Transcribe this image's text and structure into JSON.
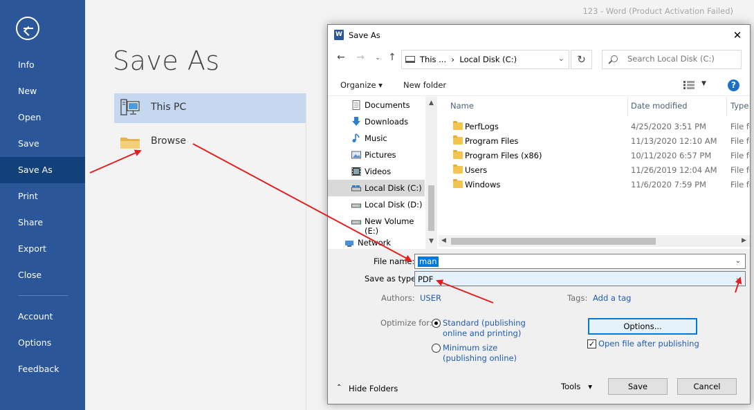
{
  "window_title": "123 - Word (Product Activation Failed)",
  "sidebar": {
    "items": [
      {
        "label": "Info",
        "active": false
      },
      {
        "label": "New",
        "active": false
      },
      {
        "label": "Open",
        "active": false
      },
      {
        "label": "Save",
        "active": false
      },
      {
        "label": "Save As",
        "active": true
      },
      {
        "label": "Print",
        "active": false
      },
      {
        "label": "Share",
        "active": false
      },
      {
        "label": "Export",
        "active": false
      },
      {
        "label": "Close",
        "active": false
      }
    ],
    "bottom_items": [
      {
        "label": "Account"
      },
      {
        "label": "Options"
      },
      {
        "label": "Feedback"
      }
    ]
  },
  "main": {
    "title": "Save As",
    "locations": [
      {
        "label": "This PC",
        "icon": "computer-icon",
        "selected": true
      },
      {
        "label": "Browse",
        "icon": "folder-icon",
        "selected": false
      }
    ]
  },
  "dialog": {
    "title": "Save As",
    "address": {
      "path_parts": [
        "This ...",
        "Local Disk (C:)"
      ],
      "search_placeholder": "Search Local Disk (C:)"
    },
    "toolbar": {
      "organize": "Organize",
      "new_folder": "New folder"
    },
    "nav_pane": [
      {
        "label": "Documents",
        "icon": "documents-icon"
      },
      {
        "label": "Downloads",
        "icon": "downloads-icon"
      },
      {
        "label": "Music",
        "icon": "music-icon"
      },
      {
        "label": "Pictures",
        "icon": "pictures-icon"
      },
      {
        "label": "Videos",
        "icon": "videos-icon"
      },
      {
        "label": "Local Disk (C:)",
        "icon": "drive-icon",
        "selected": true
      },
      {
        "label": "Local Disk (D:)",
        "icon": "drive-icon"
      },
      {
        "label": "New Volume (E:)",
        "icon": "drive-icon"
      },
      {
        "label": "Network",
        "icon": "network-icon"
      }
    ],
    "file_list": {
      "columns": [
        "Name",
        "Date modified",
        "Type"
      ],
      "rows": [
        {
          "name": "PerfLogs",
          "date": "4/25/2020 3:51 PM",
          "type": "File fo"
        },
        {
          "name": "Program Files",
          "date": "11/13/2020 12:10 AM",
          "type": "File fo"
        },
        {
          "name": "Program Files (x86)",
          "date": "10/11/2020 6:57 PM",
          "type": "File fo"
        },
        {
          "name": "Users",
          "date": "11/26/2019 12:04 AM",
          "type": "File fo"
        },
        {
          "name": "Windows",
          "date": "11/6/2020 7:59 PM",
          "type": "File fo"
        }
      ]
    },
    "file_name_label": "File name:",
    "file_name_value": "man",
    "save_type_label": "Save as type:",
    "save_type_value": "PDF",
    "authors_label": "Authors:",
    "authors_value": "USER",
    "tags_label": "Tags:",
    "tags_value": "Add a tag",
    "optimize_label": "Optimize for:",
    "optimize_options": [
      {
        "line1": "Standard (publishing",
        "line2": "online and printing)",
        "checked": true
      },
      {
        "line1": "Minimum size",
        "line2": "(publishing online)",
        "checked": false
      }
    ],
    "options_button": "Options...",
    "open_after_label": "Open file after publishing",
    "open_after_checked": true,
    "hide_folders": "Hide Folders",
    "tools": "Tools",
    "save_button": "Save",
    "cancel_button": "Cancel"
  },
  "colors": {
    "sidebar_bg": "#2b579a",
    "sidebar_active": "#124078",
    "selected_location": "#c5d8f0",
    "annotation_arrow": "#e0201f",
    "link": "#1e5bb5"
  }
}
